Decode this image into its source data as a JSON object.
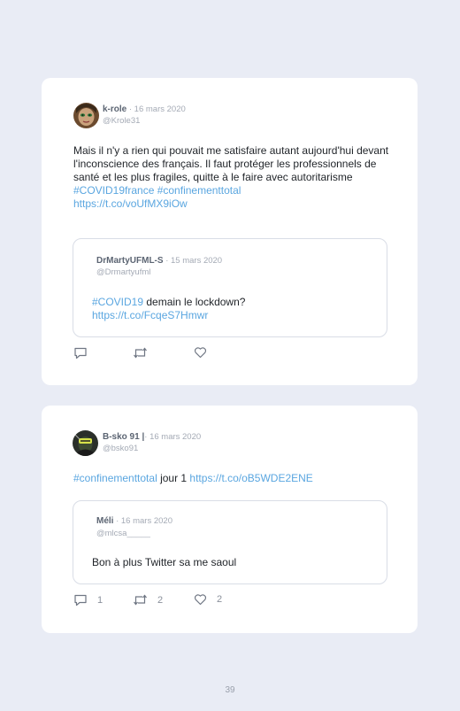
{
  "tweet1": {
    "author": "k-role",
    "date": " · 16 mars 2020",
    "handle": "@Krole31",
    "text": "Mais il n'y a rien qui pouvait me satisfaire autant aujourd'hui devant l'inconscience des français. Il faut protéger les professionnels de santé et les plus fragiles, quitte à le faire avec autoritarisme",
    "hashtags": "#COVID19france #confinementtotal",
    "link": "https://t.co/voUfMX9iOw",
    "quote": {
      "author": "DrMartyUFML-S",
      "date": " · 15 mars 2020",
      "handle": "@Drmartyufml",
      "hashtag": "#COVID19",
      "text": " demain le lockdown?",
      "link": "https://t.co/FcqeS7Hmwr"
    },
    "actions": {
      "reply": "",
      "retweet": "",
      "like": ""
    }
  },
  "tweet2": {
    "author": "B-sko 91 |",
    "date": "· 16 mars 2020",
    "handle": "@bsko91",
    "hashtag": "#confinementtotal",
    "text": " jour 1 ",
    "link": "https://t.co/oB5WDE2ENE",
    "quote": {
      "author": "Méli",
      "date": " · 16 mars 2020",
      "handle": "@mlcsa_____",
      "text": "Bon à plus Twitter sa me saoul"
    },
    "actions": {
      "reply": "1",
      "retweet": "2",
      "like": "2"
    }
  },
  "page_number": "39",
  "colors": {
    "background": "#e9ecf5",
    "link": "#5aa6e0",
    "card": "#ffffff"
  }
}
